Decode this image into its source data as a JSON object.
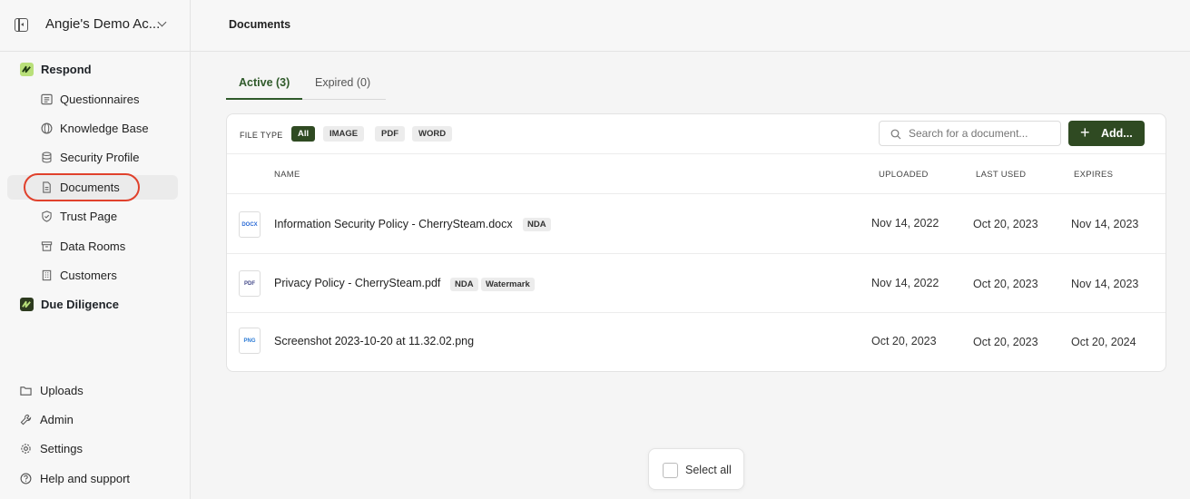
{
  "account": {
    "name": "Angie's Demo Ac..."
  },
  "sidebar": {
    "respond_label": "Respond",
    "items": [
      {
        "label": "Questionnaires"
      },
      {
        "label": "Knowledge Base"
      },
      {
        "label": "Security Profile"
      },
      {
        "label": "Documents"
      },
      {
        "label": "Trust Page"
      },
      {
        "label": "Data Rooms"
      },
      {
        "label": "Customers"
      }
    ],
    "due_diligence_label": "Due Diligence",
    "bottom": [
      {
        "label": "Uploads"
      },
      {
        "label": "Admin"
      },
      {
        "label": "Settings"
      },
      {
        "label": "Help and support"
      }
    ]
  },
  "header": {
    "title": "Documents"
  },
  "tabs": [
    {
      "label": "Active (3)"
    },
    {
      "label": "Expired (0)"
    }
  ],
  "filters": {
    "label": "FILE TYPE",
    "chips": [
      "All",
      "IMAGE",
      "PDF",
      "WORD"
    ],
    "search_placeholder": "Search for a document...",
    "add_label": "Add..."
  },
  "table": {
    "headers": [
      "NAME",
      "UPLOADED",
      "LAST USED",
      "EXPIRES"
    ],
    "rows": [
      {
        "icon": "DOCX",
        "name": "Information Security Policy - CherrySteam.docx",
        "tags": [
          "NDA"
        ],
        "uploaded": "Nov 14, 2022",
        "last_used": "Oct 20, 2023",
        "expires": "Nov 14, 2023"
      },
      {
        "icon": "PDF",
        "name": "Privacy Policy - CherrySteam.pdf",
        "tags": [
          "NDA",
          "Watermark"
        ],
        "uploaded": "Nov 14, 2022",
        "last_used": "Oct 20, 2023",
        "expires": "Nov 14, 2023"
      },
      {
        "icon": "PNG",
        "name": "Screenshot 2023-10-20 at 11.32.02.png",
        "tags": [],
        "uploaded": "Oct 20, 2023",
        "last_used": "Oct 20, 2023",
        "expires": "Oct 20, 2024"
      }
    ]
  },
  "select_all_label": "Select all",
  "colors": {
    "accent": "#2f4a22",
    "highlight": "#e0412c",
    "brand_light": "#b9e07a"
  }
}
